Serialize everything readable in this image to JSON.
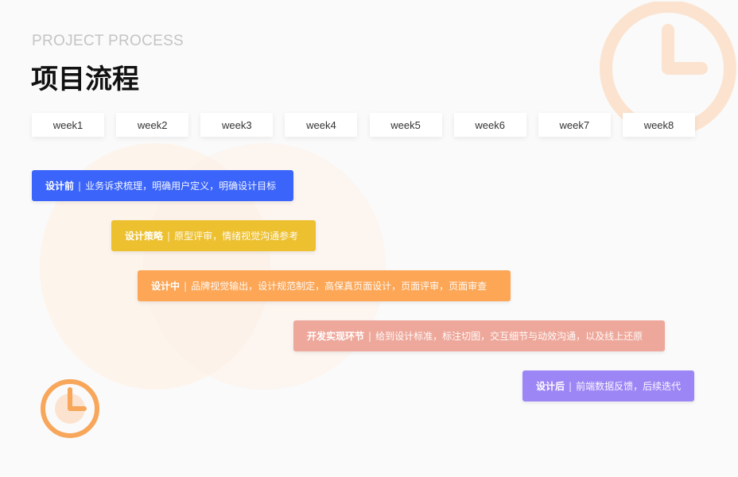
{
  "header": {
    "subtitle": "PROJECT PROCESS",
    "title": "项目流程"
  },
  "weeks": [
    "week1",
    "week2",
    "week3",
    "week4",
    "week5",
    "week6",
    "week7",
    "week8"
  ],
  "phases": [
    {
      "name": "设计前",
      "separator": "|",
      "description": "业务诉求梳理，明确用户定义，明确设计目标",
      "color": "#3a64fa"
    },
    {
      "name": "设计策略",
      "separator": "|",
      "description": "原型评审，情绪视觉沟通参考",
      "color": "#edc02f"
    },
    {
      "name": "设计中",
      "separator": "|",
      "description": "品牌视觉输出，设计规范制定，高保真页面设计，页面评审，页面审查",
      "color": "#fca656"
    },
    {
      "name": "开发实现环节",
      "separator": "|",
      "description": "给到设计标准，标注切图，交互细节与动效沟通，以及线上还原",
      "color": "#eea89b"
    },
    {
      "name": "设计后",
      "separator": "|",
      "description": "前端数据反馈，后续迭代",
      "color": "#9c86f5"
    }
  ],
  "icons": {
    "decor_top": "clock-icon",
    "decor_bottom": "clock-icon"
  },
  "colors": {
    "accent_orange": "#f7a65a",
    "light_orange": "#fbe3cf"
  }
}
